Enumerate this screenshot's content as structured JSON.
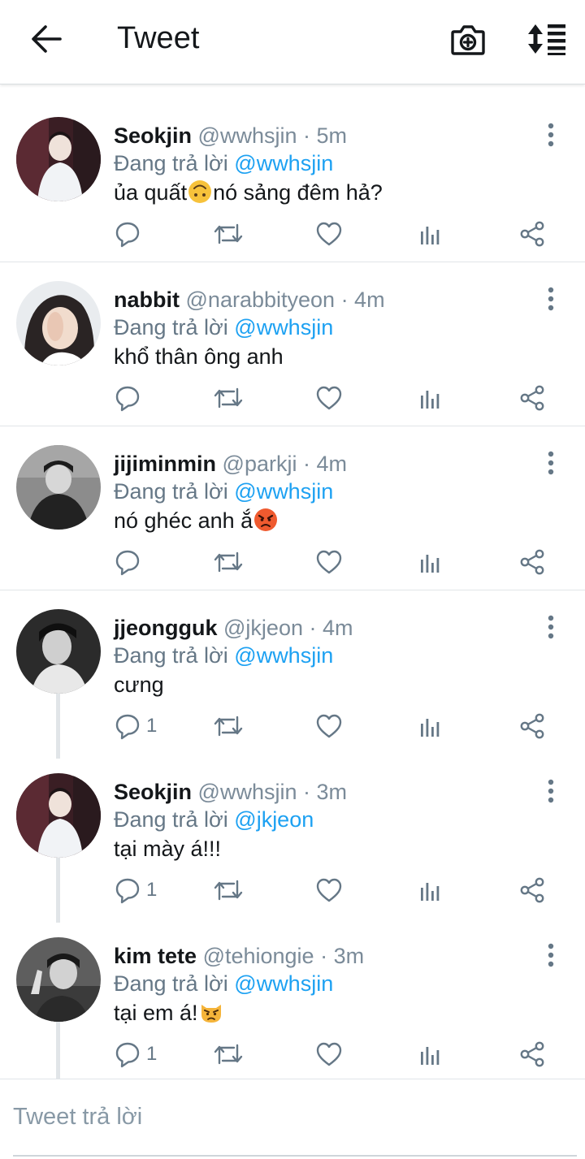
{
  "header": {
    "title": "Tweet",
    "back_icon": "arrow-left-icon",
    "camera_icon": "camera-plus-icon",
    "sort_icon": "sort-icon"
  },
  "colors": {
    "link": "#1da1f2",
    "muted": "#657786",
    "text": "#14171a",
    "divider": "#e1e5e8"
  },
  "tweets": [
    {
      "name": "Seokjin",
      "handle": "@wwhsjin",
      "time": "· 5m",
      "reply_prefix": "Đang trả lời",
      "reply_to": "@wwhsjin",
      "text": "ủa quất",
      "emoji": "upside-down-face",
      "text_after": "nó sảng đêm hả?",
      "reply_count": "",
      "avatar": "avatar-seokjin"
    },
    {
      "name": "nabbit",
      "handle": "@narabbityeon",
      "time": "· 4m",
      "reply_prefix": "Đang trả lời",
      "reply_to": "@wwhsjin",
      "text": "khổ thân ông anh",
      "emoji": "",
      "text_after": "",
      "reply_count": "",
      "avatar": "avatar-nabbit"
    },
    {
      "name": "jijiminmin",
      "handle": "@parkji",
      "time": "· 4m",
      "reply_prefix": "Đang trả lời",
      "reply_to": "@wwhsjin",
      "text": "nó ghéc anh ắ",
      "emoji": "angry-face",
      "text_after": "",
      "reply_count": "",
      "avatar": "avatar-jijiminmin"
    },
    {
      "name": "jjeongguk",
      "handle": "@jkjeon",
      "time": "· 4m",
      "reply_prefix": "Đang trả lời",
      "reply_to": "@wwhsjin",
      "text": "cưng",
      "emoji": "",
      "text_after": "",
      "reply_count": "1",
      "avatar": "avatar-jjeongguk"
    },
    {
      "name": "Seokjin",
      "handle": "@wwhsjin",
      "time": "· 3m",
      "reply_prefix": "Đang trả lời",
      "reply_to": "@jkjeon",
      "text": "tại mày á!!!",
      "emoji": "",
      "text_after": "",
      "reply_count": "1",
      "avatar": "avatar-seokjin"
    },
    {
      "name": "kim tete",
      "handle": "@tehiongie",
      "time": "· 3m",
      "reply_prefix": "Đang trả lời",
      "reply_to": "@wwhsjin",
      "text": "tại em á!",
      "emoji": "pouting-cat",
      "text_after": "",
      "reply_count": "1",
      "avatar": "avatar-kimtete"
    }
  ],
  "composer": {
    "placeholder": "Tweet trả lời"
  }
}
